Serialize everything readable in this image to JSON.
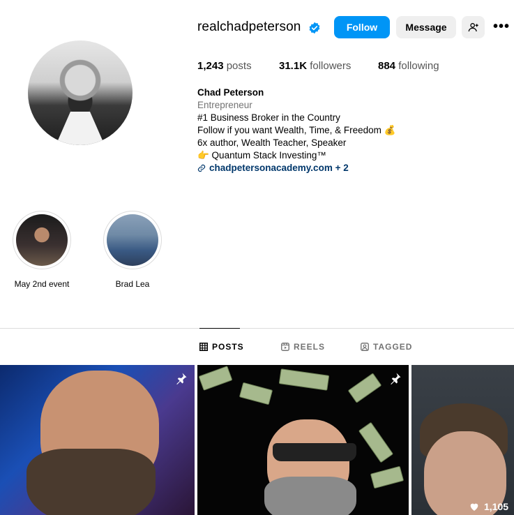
{
  "profile": {
    "username": "realchadpeterson",
    "follow_label": "Follow",
    "message_label": "Message",
    "more_label": "•••"
  },
  "stats": {
    "posts_count": "1,243",
    "posts_label": "posts",
    "followers_count": "31.1K",
    "followers_label": "followers",
    "following_count": "884",
    "following_label": "following"
  },
  "bio": {
    "name": "Chad Peterson",
    "category": "Entrepreneur",
    "line1": "#1 Business Broker in the Country",
    "line2": "Follow if you want Wealth, Time, & Freedom 💰",
    "line3": "6x author, Wealth Teacher, Speaker",
    "line4": "👉 Quantum Stack Investing™",
    "link": "chadpetersonacademy.com + 2"
  },
  "highlights": [
    {
      "label": "May 2nd event"
    },
    {
      "label": "Brad Lea"
    }
  ],
  "tabs": [
    {
      "label": "POSTS"
    },
    {
      "label": "REELS"
    },
    {
      "label": "TAGGED"
    }
  ],
  "posts": [
    {
      "pinned": true
    },
    {
      "pinned": true
    },
    {
      "likes": "1,105"
    }
  ],
  "colors": {
    "accent": "#0095f6",
    "link": "#00376b",
    "secondary_text": "#737373"
  }
}
